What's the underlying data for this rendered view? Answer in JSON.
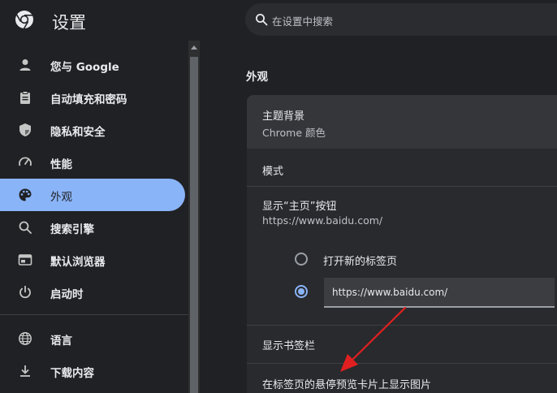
{
  "header": {
    "title": "设置",
    "search_placeholder": "在设置中搜索"
  },
  "sidebar": {
    "items": [
      {
        "label": "您与 Google",
        "icon": "person-icon"
      },
      {
        "label": "自动填充和密码",
        "icon": "clipboard-icon"
      },
      {
        "label": "隐私和安全",
        "icon": "shield-icon"
      },
      {
        "label": "性能",
        "icon": "speedometer-icon"
      },
      {
        "label": "外观",
        "icon": "palette-icon",
        "active": true
      },
      {
        "label": "搜索引擎",
        "icon": "search-icon"
      },
      {
        "label": "默认浏览器",
        "icon": "browser-icon"
      },
      {
        "label": "启动时",
        "icon": "power-icon"
      },
      {
        "label": "语言",
        "icon": "globe-icon"
      },
      {
        "label": "下载内容",
        "icon": "download-icon"
      }
    ]
  },
  "main": {
    "section_title": "外观",
    "theme": {
      "label": "主题背景",
      "value": "Chrome 颜色"
    },
    "mode": {
      "label": "模式"
    },
    "home_button": {
      "label": "显示“主页”按钮",
      "value": "https://www.baidu.com/",
      "options": [
        {
          "label": "打开新的标签页",
          "checked": false
        },
        {
          "label": "https://www.baidu.com/",
          "checked": true
        }
      ]
    },
    "bookmarks_bar": {
      "label": "显示书签栏"
    },
    "hover_preview": {
      "label": "在标签页的悬停预览卡片上显示图片"
    }
  },
  "colors": {
    "accent": "#8ab4f8",
    "annotation_arrow": "#e02020"
  }
}
